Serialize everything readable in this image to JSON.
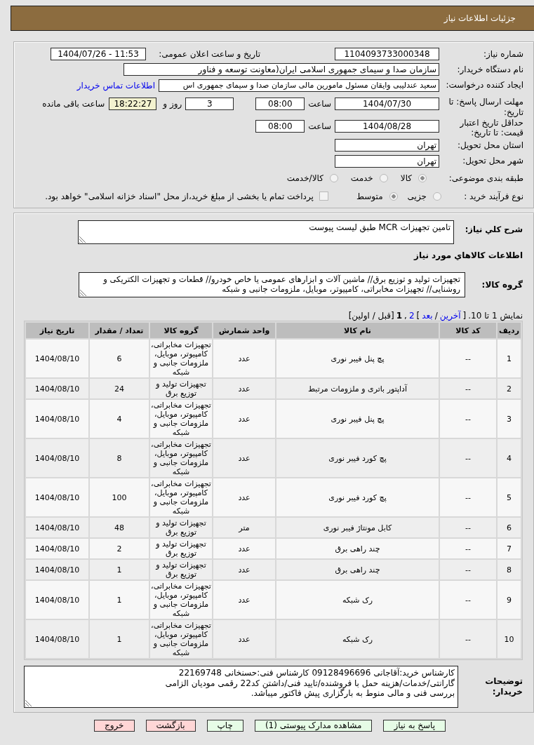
{
  "header": {
    "title": "جزئیات اطلاعات نیاز"
  },
  "form": {
    "need_number": {
      "label": "شماره نیاز:",
      "value": "1104093733000348"
    },
    "announced": {
      "label": "تاریخ و ساعت اعلان عمومی:",
      "value": "1404/07/26 - 11:53"
    },
    "buyer": {
      "label": "نام دستگاه خریدار:",
      "value": "سازمان صدا و سیمای جمهوری اسلامی ایران(معاونت توسعه و فناور"
    },
    "creator": {
      "label": "ایجاد کننده درخواست:",
      "value": "سعید عندلیبی وایقان مسئول مامورین مالی سازمان صدا و سیمای جمهوری اس",
      "link": "اطلاعات تماس خریدار"
    },
    "deadline": {
      "label": "مهلت ارسال پاسخ: تا تاریخ:",
      "date": "1404/07/30",
      "time_label": "ساعت",
      "time": "08:00",
      "days": "3",
      "days_label": "روز و",
      "remaining": "18:22:27",
      "remaining_label": "ساعت باقی مانده"
    },
    "validity": {
      "label": "حداقل تاریخ اعتبار قیمت: تا تاریخ:",
      "date": "1404/08/28",
      "time_label": "ساعت",
      "time": "08:00"
    },
    "province": {
      "label": "استان محل تحویل:",
      "value": "تهران"
    },
    "city": {
      "label": "شهر محل تحویل:",
      "value": "تهران"
    },
    "category": {
      "label": "طبقه بندی موضوعی:",
      "options": [
        {
          "label": "کالا",
          "selected": true
        },
        {
          "label": "خدمت",
          "selected": false
        },
        {
          "label": "کالا/خدمت",
          "selected": false
        }
      ]
    },
    "process": {
      "label": "نوع فرآیند خرید :",
      "options": [
        {
          "label": "جزیی",
          "selected": false
        },
        {
          "label": "متوسط",
          "selected": true
        }
      ],
      "treasury": {
        "label": "پرداخت تمام یا بخشی از مبلغ خرید،از محل \"اسناد خزانه اسلامی\" خواهد بود.",
        "checked": false
      }
    }
  },
  "description": {
    "label": "شرح کلي نیاز:",
    "value": "تامین تجهیزات MCR طبق لیست پیوست"
  },
  "goods": {
    "heading": "اطلاعات کالاهاي مورد نیاز",
    "group_label": "گروه کالا:",
    "group_value": "تجهیزات تولید و توزیع برق// ماشین آلات و ابزارهای عمومی یا خاص خودرو// قطعات و تجهیزات الکتریکی و روشنایی// تجهیزات مخابراتی، کامپیوتر، موبایل، ملزومات جانبی و شبکه"
  },
  "pager": {
    "summary": "نمایش 1 تا 10.",
    "parts": [
      {
        "kind": "text",
        "text": "["
      },
      {
        "kind": "link",
        "text": "آخرین"
      },
      {
        "kind": "text",
        "text": "/"
      },
      {
        "kind": "link",
        "text": "بعد"
      },
      {
        "kind": "text",
        "text": "]"
      },
      {
        "kind": "link",
        "text": "2"
      },
      {
        "kind": "text",
        "text": ","
      },
      {
        "kind": "current",
        "text": "1"
      },
      {
        "kind": "text",
        "text": "[قبل / اولین]"
      }
    ]
  },
  "table": {
    "columns": [
      "ردیف",
      "کد کالا",
      "نام کالا",
      "واحد شمارش",
      "گروه کالا",
      "تعداد / مقدار",
      "تاریخ نیاز"
    ],
    "rows": [
      [
        "1",
        "--",
        "پچ پنل فیبر نوری",
        "عدد",
        "تجهیزات مخابراتی، کامپیوتر، موبایل، ملزومات جانبی و شبکه",
        "6",
        "1404/08/10"
      ],
      [
        "2",
        "--",
        "آداپتور باتری و ملزومات مرتبط",
        "عدد",
        "تجهیزات تولید و توزیع برق",
        "24",
        "1404/08/10"
      ],
      [
        "3",
        "--",
        "پچ پنل فیبر نوری",
        "عدد",
        "تجهیزات مخابراتی، کامپیوتر، موبایل، ملزومات جانبی و شبکه",
        "4",
        "1404/08/10"
      ],
      [
        "4",
        "--",
        "پچ کورد فیبر نوری",
        "عدد",
        "تجهیزات مخابراتی، کامپیوتر، موبایل، ملزومات جانبی و شبکه",
        "8",
        "1404/08/10"
      ],
      [
        "5",
        "--",
        "پچ کورد فیبر نوری",
        "عدد",
        "تجهیزات مخابراتی، کامپیوتر، موبایل، ملزومات جانبی و شبکه",
        "100",
        "1404/08/10"
      ],
      [
        "6",
        "--",
        "کابل مونتاژ فیبر نوری",
        "متر",
        "تجهیزات تولید و توزیع برق",
        "48",
        "1404/08/10"
      ],
      [
        "7",
        "--",
        "چند راهی برق",
        "عدد",
        "تجهیزات تولید و توزیع برق",
        "2",
        "1404/08/10"
      ],
      [
        "8",
        "--",
        "چند راهی برق",
        "عدد",
        "تجهیزات تولید و توزیع برق",
        "1",
        "1404/08/10"
      ],
      [
        "9",
        "--",
        "رک شبکه",
        "عدد",
        "تجهیزات مخابراتی، کامپیوتر، موبایل، ملزومات جانبی و شبکه",
        "1",
        "1404/08/10"
      ],
      [
        "10",
        "--",
        "رک شبکه",
        "عدد",
        "تجهیزات مخابراتی، کامپیوتر، موبایل، ملزومات جانبی و شبکه",
        "1",
        "1404/08/10"
      ]
    ]
  },
  "notes": {
    "label": "توضیحات خریدار:",
    "lines": [
      "کارشناس خرید:آقاجانی 09128496696 کارشناس فنی:حسنخانی 22169748",
      "گارانتی/خدمات/هزینه حمل با فروشنده/تایید فنی/داشتن کد22 رقمی مودیان الزامی",
      "بررسی فنی و مالی منوط به بارگزاری پیش فاکتور میباشد."
    ]
  },
  "buttons": [
    {
      "label": "پاسخ به نیاز",
      "kind": "action"
    },
    {
      "label": "مشاهده مدارک پیوستی (1)",
      "kind": "action"
    },
    {
      "label": "چاپ",
      "kind": "action"
    },
    {
      "label": "بازگشت",
      "kind": "exit"
    },
    {
      "label": "خروج",
      "kind": "exit"
    }
  ]
}
